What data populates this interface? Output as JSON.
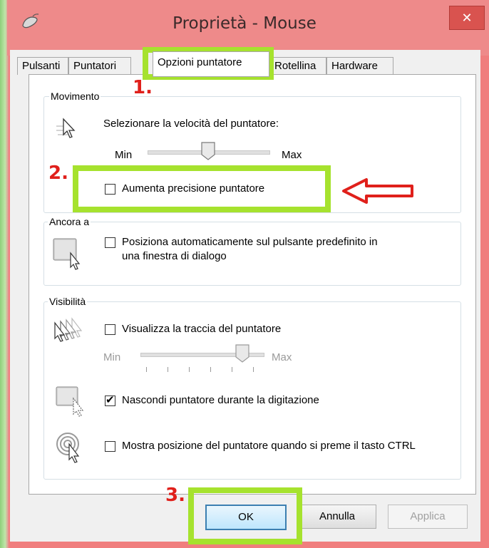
{
  "window": {
    "title": "Proprietà - Mouse",
    "close_label": "✕",
    "background": "#f07e7e",
    "icon": "mouse-icon"
  },
  "tabs": [
    {
      "label": "Pulsanti"
    },
    {
      "label": "Puntatori"
    },
    {
      "label": "Opzioni puntatore",
      "active": true
    },
    {
      "label": "Rotellina"
    },
    {
      "label": "Hardware"
    }
  ],
  "movimento": {
    "title": "Movimento",
    "speed_label": "Selezionare la velocità del puntatore:",
    "min_label": "Min",
    "max_label": "Max",
    "speed_level_fraction": 0.5,
    "precision_label": "Aumenta precisione puntatore",
    "precision_checked": false
  },
  "ancora": {
    "title": "Ancora a",
    "snap_label_line1": "Posiziona automaticamente sul pulsante predefinito in",
    "snap_label_line2": "una finestra di dialogo",
    "snap_checked": false
  },
  "visibilita": {
    "title": "Visibilità",
    "trail_label": "Visualizza la traccia del puntatore",
    "trail_checked": false,
    "trail_min_label": "Min",
    "trail_max_label": "Max",
    "trail_level_fraction": 0.83,
    "hide_label": "Nascondi puntatore durante la digitazione",
    "hide_checked": true,
    "ctrl_label": "Mostra posizione del puntatore quando si preme il tasto CTRL",
    "ctrl_checked": false
  },
  "buttons": {
    "ok": "OK",
    "cancel": "Annulla",
    "apply": "Applica"
  },
  "annotations": {
    "step1": "1.",
    "step2": "2.",
    "step3": "3.",
    "highlight_color": "#a6e22e",
    "annotation_color": "#e0201b"
  }
}
